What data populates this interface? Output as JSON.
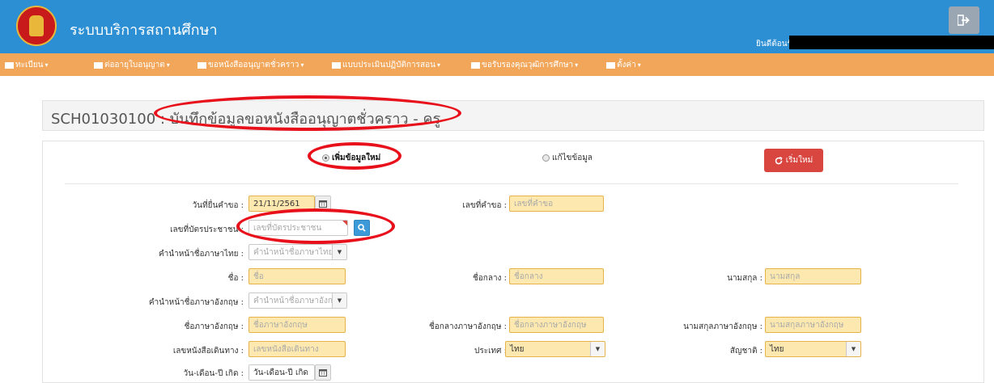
{
  "app": {
    "title": "ระบบบริการสถานศึกษา",
    "welcome": "ยินดีต้อนรับ"
  },
  "menu": [
    {
      "label": "ทะเบียน"
    },
    {
      "label": "ต่ออายุใบอนุญาต"
    },
    {
      "label": "ขอหนังสืออนุญาตชั่วคราว"
    },
    {
      "label": "แบบประเมินปฏิบัติการสอน"
    },
    {
      "label": "ขอรับรองคุณวุฒิการศึกษา"
    },
    {
      "label": "ตั้งค่า"
    }
  ],
  "page": {
    "code_title": "SCH01030100 : บันทึกข้อมูลขอหนังสืออนุญาตชั่วคราว - ครู"
  },
  "mode": {
    "add_label": "เพิ่มข้อมูลใหม่",
    "edit_label": "แก้ไขข้อมูล",
    "selected": "add"
  },
  "reset_label": "เริ่มใหม่",
  "form": {
    "request_date": {
      "label": "วันที่ยื่นคำขอ :",
      "value": "21/11/2561"
    },
    "request_no": {
      "label": "เลขที่คำขอ :",
      "placeholder": "เลขที่คำขอ"
    },
    "citizen_id": {
      "label": "เลขที่บัตรประชาชน :",
      "placeholder": "เลขที่บัตรประชาชน"
    },
    "th_prefix": {
      "label": "คำนำหน้าชื่อภาษาไทย :",
      "placeholder": "คำนำหน้าชื่อภาษาไทย"
    },
    "first_name": {
      "label": "ชื่อ :",
      "placeholder": "ชื่อ"
    },
    "middle_name": {
      "label": "ชื่อกลาง :",
      "placeholder": "ชื่อกลาง"
    },
    "last_name": {
      "label": "นามสกุล :",
      "placeholder": "นามสกุล"
    },
    "en_prefix": {
      "label": "คำนำหน้าชื่อภาษาอังกฤษ :",
      "placeholder": "คำนำหน้าชื่อภาษาอังกฤษ"
    },
    "en_first": {
      "label": "ชื่อภาษาอังกฤษ :",
      "placeholder": "ชื่อภาษาอังกฤษ"
    },
    "en_middle": {
      "label": "ชื่อกลางภาษาอังกฤษ :",
      "placeholder": "ชื่อกลางภาษาอังกฤษ"
    },
    "en_last": {
      "label": "นามสกุลภาษาอังกฤษ :",
      "placeholder": "นามสกุลภาษาอังกฤษ"
    },
    "passport": {
      "label": "เลขหนังสือเดินทาง :",
      "placeholder": "เลขหนังสือเดินทาง"
    },
    "country": {
      "label": "ประเทศ :",
      "value": "ไทย"
    },
    "nationality": {
      "label": "สัญชาติ :",
      "value": "ไทย"
    },
    "birth_date": {
      "label": "วัน-เดือน-ปี เกิด :",
      "placeholder": "วัน-เดือน-ปี เกิด"
    }
  },
  "colors": {
    "topbar": "#2c8fd4",
    "menubar": "#f2a65a",
    "highlight": "#e8101a",
    "reset": "#d9453f"
  },
  "icons": {
    "logout": "logout-icon",
    "calendar": "calendar-icon",
    "search": "search-icon",
    "refresh": "refresh-icon"
  }
}
